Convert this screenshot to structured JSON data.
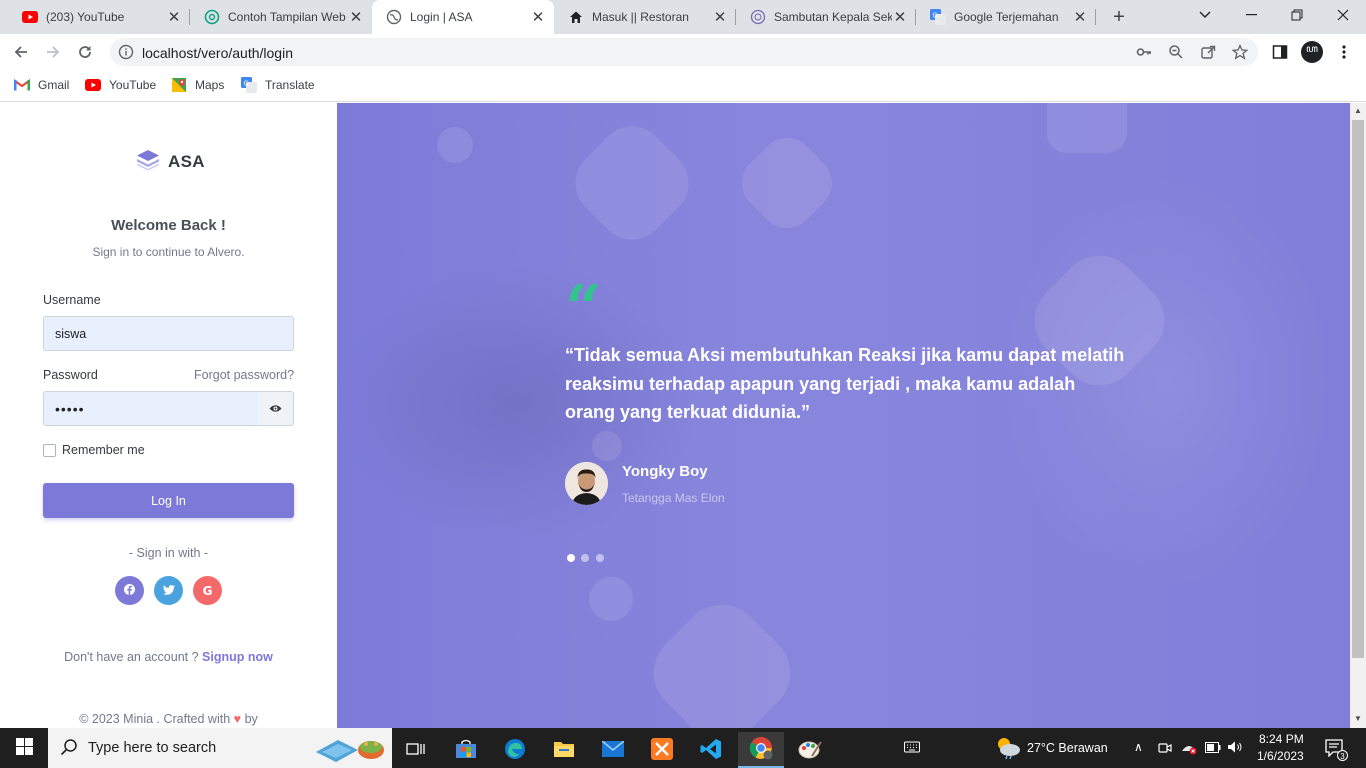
{
  "browser": {
    "tabs": [
      {
        "title": "(203) YouTube",
        "icon": "youtube-icon"
      },
      {
        "title": "Contoh Tampilan Web",
        "icon": "chatgpt-icon"
      },
      {
        "title": "Login | ASA",
        "icon": "globe-icon",
        "active": true
      },
      {
        "title": "Masuk || Restoran",
        "icon": "home-icon"
      },
      {
        "title": "Sambutan Kepala Sek",
        "icon": "school-logo-icon"
      },
      {
        "title": "Google Terjemahan",
        "icon": "google-translate-icon"
      }
    ],
    "url": "localhost/vero/auth/login",
    "profile_initial": "ꦲ",
    "bookmarks": [
      {
        "label": "Gmail",
        "icon": "gmail-icon"
      },
      {
        "label": "YouTube",
        "icon": "youtube-icon"
      },
      {
        "label": "Maps",
        "icon": "maps-icon"
      },
      {
        "label": "Translate",
        "icon": "google-translate-icon"
      }
    ]
  },
  "login": {
    "brand": "ASA",
    "welcome": "Welcome Back !",
    "subtitle": "Sign in to continue to Alvero.",
    "username_label": "Username",
    "username_value": "siswa",
    "password_label": "Password",
    "forgot": "Forgot password?",
    "password_value": "•••••",
    "remember": "Remember me",
    "login_button": "Log In",
    "signin_with": "- Sign in with -",
    "signup_prompt": "Don't have an account ?",
    "signup_link": "Signup now",
    "footer_prefix": "© 2023 Minia . Crafted with",
    "footer_suffix": "by"
  },
  "testimonial": {
    "quote": "“Tidak semua Aksi membutuhkan Reaksi jika kamu dapat melatih reaksimu terhadap apapun yang terjadi , maka kamu adalah orang yang terkuat didunia.”",
    "name": "Yongky Boy",
    "role": "Tetangga Mas Elon",
    "slides": 3,
    "active_slide": 1
  },
  "taskbar": {
    "search_placeholder": "Type here to search",
    "weather": "27°C  Berawan",
    "time": "8:24 PM",
    "date": "1/6/2023",
    "notification_count": "3"
  },
  "colors": {
    "accent": "#7c79d8",
    "quote_icon": "#34c38f",
    "facebook": "#7c79d8",
    "twitter": "#4aa3df",
    "google": "#f46a6a"
  }
}
